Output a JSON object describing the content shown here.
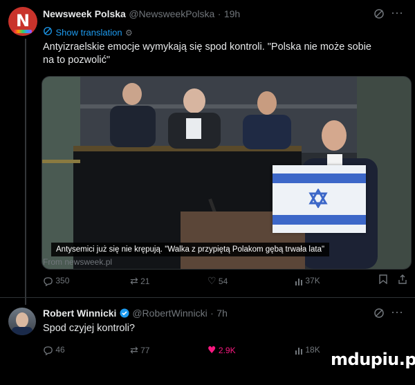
{
  "tweet1": {
    "author_name": "Newsweek Polska",
    "handle": "@NewsweekPolska",
    "dot": "·",
    "time": "19h",
    "show_translation": "Show translation",
    "text_line1": "Antyizraelskie emocje wymykają się spod kontroli. \"Polska nie może sobie",
    "text_line2": "na to pozwolić\"",
    "media_caption": "Antysemici już się nie krępują. \"Walka z przypiętą Polakom gębą trwała lata\"",
    "source": "From newsweek.pl",
    "replies": "350",
    "retweets": "21",
    "likes": "54",
    "views": "37K"
  },
  "tweet2": {
    "author_name": "Robert Winnicki",
    "handle": "@RobertWinnicki",
    "dot": "·",
    "time": "7h",
    "text": "Spod czyjej kontroli?",
    "replies": "46",
    "retweets": "77",
    "likes": "2.9K",
    "views": "18K"
  },
  "watermark": "mdupiu.pl",
  "colors": {
    "background": "#000000",
    "link": "#1d9bf0",
    "like_active": "#f91880",
    "verified": "#1d9bf0"
  },
  "icons": [
    "grok-icon",
    "more-icon",
    "translate-icon",
    "reply-icon",
    "retweet-icon",
    "like-icon",
    "views-icon",
    "bookmark-icon",
    "share-icon",
    "verified-badge-icon"
  ]
}
